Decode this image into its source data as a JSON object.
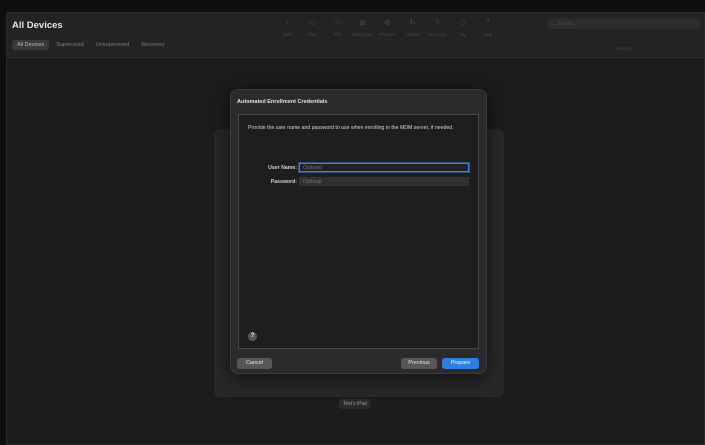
{
  "window": {
    "title": "All Devices"
  },
  "tabs": [
    {
      "label": "All Devices",
      "active": true
    },
    {
      "label": "Supervised",
      "active": false
    },
    {
      "label": "Unsupervised",
      "active": false
    },
    {
      "label": "Recovery",
      "active": false
    }
  ],
  "toolbar": {
    "tools": [
      {
        "icon": "back-icon",
        "glyph": "‹",
        "label": "Back"
      },
      {
        "icon": "view-icon",
        "glyph": "▭",
        "label": "View"
      },
      {
        "icon": "info-icon",
        "glyph": "ⓘ",
        "label": "Info"
      },
      {
        "icon": "blueprints-icon",
        "glyph": "⊞",
        "label": "Blueprints"
      },
      {
        "icon": "prepare-icon",
        "glyph": "⚙",
        "label": "Prepare"
      },
      {
        "icon": "update-icon",
        "glyph": "↻",
        "label": "Update"
      },
      {
        "icon": "backup-icon",
        "glyph": "⇪",
        "label": "Back Up"
      },
      {
        "icon": "tag-icon",
        "glyph": "◇",
        "label": "Tag"
      },
      {
        "icon": "help-icon",
        "glyph": "?",
        "label": "Help"
      }
    ],
    "search_placeholder": "Search",
    "search_label": "Search"
  },
  "device": {
    "name": "Test's iPad"
  },
  "sheet": {
    "title": "Automated Enrollment Credentials",
    "description": "Provide the user name and password to use when enrolling in the MDM server, if needed.",
    "username": {
      "label": "User Name:",
      "value": "",
      "placeholder": "Optional"
    },
    "password": {
      "label": "Password:",
      "value": "",
      "placeholder": "Optional"
    },
    "help_glyph": "?",
    "buttons": {
      "cancel": "Cancel",
      "previous": "Previous",
      "prepare": "Prepare"
    }
  },
  "colors": {
    "accent": "#2d7fe3",
    "focus_ring": "#3f83d8"
  }
}
